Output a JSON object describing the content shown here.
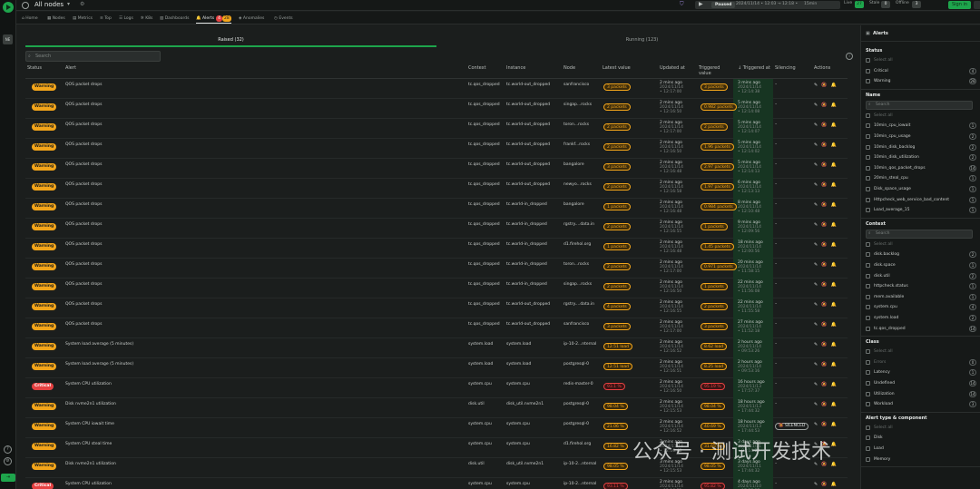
{
  "topbar": {
    "space": "All nodes",
    "state": "Paused",
    "range": "2024/11/14 • 12:03 → 12:18 • ",
    "ago": "15min",
    "live_label": "Live",
    "live_count": "27",
    "stale_label": "Stale",
    "stale_count": "0",
    "offline_label": "Offline",
    "offline_count": "3",
    "signin": "Sign in",
    "alerts_count": "1"
  },
  "rail": {
    "node_short": "NE"
  },
  "tabs": [
    "Home",
    "Nodes",
    "Metrics",
    "Top",
    "Logs",
    "K8s",
    "Dashboards",
    "Alerts",
    "Anomalies",
    "Events"
  ],
  "alert_badges": {
    "critical": "4",
    "warning": "28"
  },
  "subtabs": {
    "raised": "Raised (32)",
    "running": "Running (123)"
  },
  "search_placeholder": "Search",
  "columns": [
    "Status",
    "Alert",
    "Context",
    "Instance",
    "Node",
    "Latest value",
    "Updated at",
    "Triggered value",
    "↓ Triggered at",
    "Silencing",
    "Actions"
  ],
  "rows": [
    {
      "status": "Warning",
      "alert": "QOS packet drops",
      "context": "tc.qos_dropped",
      "instance": "tc.world-out_dropped",
      "node": "sanfrancisco",
      "value": "3 packets",
      "updated": "2 mins ago",
      "updated_ts": "2024/11/14 • 12:17:00",
      "tvalue": "3 packets",
      "tat": "3 mins ago",
      "tat_ts": "2024/11/14 • 12:14:38",
      "sil": "–"
    },
    {
      "status": "Warning",
      "alert": "QOS packet drops",
      "context": "tc.qos_dropped",
      "instance": "tc.world-out_dropped",
      "node": "singap...rocks",
      "value": "2 packets",
      "updated": "2 mins ago",
      "updated_ts": "2024/11/14 • 12:16:50",
      "tvalue": "0.982 packets",
      "tat": "5 mins ago",
      "tat_ts": "2024/11/14 • 12:14:08",
      "sil": "–"
    },
    {
      "status": "Warning",
      "alert": "QOS packet drops",
      "context": "tc.qos_dropped",
      "instance": "tc.world-out_dropped",
      "node": "toron...rocks",
      "value": "2 packets",
      "updated": "2 mins ago",
      "updated_ts": "2024/11/14 • 12:17:00",
      "tvalue": "2 packets",
      "tat": "5 mins ago",
      "tat_ts": "2024/11/14 • 12:14:07",
      "sil": "–"
    },
    {
      "status": "Warning",
      "alert": "QOS packet drops",
      "context": "tc.qos_dropped",
      "instance": "tc.world-out_dropped",
      "node": "frankf...rocks",
      "value": "2 packets",
      "updated": "2 mins ago",
      "updated_ts": "2024/11/14 • 12:16:50",
      "tvalue": "1.96 packets",
      "tat": "5 mins ago",
      "tat_ts": "2024/11/14 • 12:14:02",
      "sil": "–"
    },
    {
      "status": "Warning",
      "alert": "QOS packet drops",
      "context": "tc.qos_dropped",
      "instance": "tc.world-out_dropped",
      "node": "bangalore",
      "value": "3 packets",
      "updated": "2 mins ago",
      "updated_ts": "2024/11/14 • 12:16:48",
      "tvalue": "2.97 packets",
      "tat": "5 mins ago",
      "tat_ts": "2024/11/14 • 12:14:13",
      "sil": "–"
    },
    {
      "status": "Warning",
      "alert": "QOS packet drops",
      "context": "tc.qos_dropped",
      "instance": "tc.world-out_dropped",
      "node": "newyo...rocks",
      "value": "2 packets",
      "updated": "2 mins ago",
      "updated_ts": "2024/11/14 • 12:16:58",
      "tvalue": "1.97 packets",
      "tat": "6 mins ago",
      "tat_ts": "2024/11/14 • 12:13:13",
      "sil": "–"
    },
    {
      "status": "Warning",
      "alert": "QOS packet drops",
      "context": "tc.qos_dropped",
      "instance": "tc.world-in_dropped",
      "node": "bangalore",
      "value": "1 packets",
      "updated": "2 mins ago",
      "updated_ts": "2024/11/14 • 12:16:48",
      "tvalue": "0.984 packets",
      "tat": "8 mins ago",
      "tat_ts": "2024/11/14 • 12:10:48",
      "sil": "–"
    },
    {
      "status": "Warning",
      "alert": "QOS packet drops",
      "context": "tc.qos_dropped",
      "instance": "tc.world-in_dropped",
      "node": "rgstry....data.in",
      "value": "2 packets",
      "updated": "2 mins ago",
      "updated_ts": "2024/11/14 • 12:16:55",
      "tvalue": "1 packets",
      "tat": "9 mins ago",
      "tat_ts": "2024/11/14 • 12:09:56",
      "sil": "–"
    },
    {
      "status": "Warning",
      "alert": "QOS packet drops",
      "context": "tc.qos_dropped",
      "instance": "tc.world-in_dropped",
      "node": "d1.firehol.org",
      "value": "1 packets",
      "updated": "2 mins ago",
      "updated_ts": "2024/11/14 • 12:16:48",
      "tvalue": "1.45 packets",
      "tat": "18 mins ago",
      "tat_ts": "2024/11/14 • 12:00:56",
      "sil": "–"
    },
    {
      "status": "Warning",
      "alert": "QOS packet drops",
      "context": "tc.qos_dropped",
      "instance": "tc.world-in_dropped",
      "node": "toron...rocks",
      "value": "2 packets",
      "updated": "2 mins ago",
      "updated_ts": "2024/11/14 • 12:17:00",
      "tvalue": "0.971 packets",
      "tat": "20 mins ago",
      "tat_ts": "2024/11/14 • 11:58:15",
      "sil": "–"
    },
    {
      "status": "Warning",
      "alert": "QOS packet drops",
      "context": "tc.qos_dropped",
      "instance": "tc.world-in_dropped",
      "node": "singap...rocks",
      "value": "2 packets",
      "updated": "2 mins ago",
      "updated_ts": "2024/11/14 • 12:16:50",
      "tvalue": "1 packets",
      "tat": "22 mins ago",
      "tat_ts": "2024/11/14 • 11:56:08",
      "sil": "–"
    },
    {
      "status": "Warning",
      "alert": "QOS packet drops",
      "context": "tc.qos_dropped",
      "instance": "tc.world-out_dropped",
      "node": "rgstry....data.in",
      "value": "4 packets",
      "updated": "2 mins ago",
      "updated_ts": "2024/11/14 • 12:16:55",
      "tvalue": "2 packets",
      "tat": "22 mins ago",
      "tat_ts": "2024/11/14 • 11:55:58",
      "sil": "–"
    },
    {
      "status": "Warning",
      "alert": "QOS packet drops",
      "context": "tc.qos_dropped",
      "instance": "tc.world-out_dropped",
      "node": "sanfrancisco",
      "value": "3 packets",
      "updated": "2 mins ago",
      "updated_ts": "2024/11/14 • 12:17:00",
      "tvalue": "3 packets",
      "tat": "27 mins ago",
      "tat_ts": "2024/11/14 • 11:52:18",
      "sil": "–"
    },
    {
      "status": "Warning",
      "alert": "System load average (5 minutes)",
      "context": "system.load",
      "instance": "system.load",
      "node": "ip-10-2...nternal",
      "value": "12.51 load",
      "updated": "2 mins ago",
      "updated_ts": "2024/11/14 • 12:16:52",
      "tvalue": "8.62 load",
      "tat": "2 hours ago",
      "tat_ts": "2024/11/14 • 09:53:26",
      "sil": "–"
    },
    {
      "status": "Warning",
      "alert": "System load average (5 minutes)",
      "context": "system.load",
      "instance": "system.load",
      "node": "postgresql-0",
      "value": "12.51 load",
      "updated": "2 mins ago",
      "updated_ts": "2024/11/14 • 12:16:51",
      "tvalue": "8.25 load",
      "tat": "2 hours ago",
      "tat_ts": "2024/11/14 • 09:53:16",
      "sil": "–"
    },
    {
      "status": "Critical",
      "alert": "System CPU utilization",
      "context": "system.cpu",
      "instance": "system.cpu",
      "node": "redis-master-0",
      "value": "93.1 %",
      "updated": "2 mins ago",
      "updated_ts": "2024/11/14 • 12:16:50",
      "tvalue": "95.19 %",
      "tat": "16 hours ago",
      "tat_ts": "2024/11/13 • 17:57:37",
      "sil": "–"
    },
    {
      "status": "Warning",
      "alert": "Disk nvme2n1 utilization",
      "context": "disk.util",
      "instance": "disk_util.nvme2n1",
      "node": "postgresql-0",
      "value": "98.04 %",
      "updated": "2 mins ago",
      "updated_ts": "2024/11/14 • 12:15:53",
      "tvalue": "98.04 %",
      "tat": "18 hours ago",
      "tat_ts": "2024/11/13 • 17:44:32",
      "sil": "–"
    },
    {
      "status": "Warning",
      "alert": "System CPU iowait time",
      "context": "system.cpu",
      "instance": "system.cpu",
      "node": "postgresql-0",
      "value": "21.06 %",
      "updated": "2 mins ago",
      "updated_ts": "2024/11/14 • 12:16:52",
      "tvalue": "40.69 %",
      "tat": "18 hours ago",
      "tat_ts": "2024/11/13 • 17:44:53",
      "sil": "SILENCED"
    },
    {
      "status": "Warning",
      "alert": "System CPU steal time",
      "context": "system.cpu",
      "instance": "system.cpu",
      "node": "d1.firehol.org",
      "value": "16.82 %",
      "updated": "2 mins ago",
      "updated_ts": "2024/11/14 • 12:16:48",
      "tvalue": "31.65 %",
      "tat": "3 days ago",
      "tat_ts": "2024/11/11 • 04:14:29",
      "sil": "–"
    },
    {
      "status": "Warning",
      "alert": "Disk nvme2n1 utilization",
      "context": "disk.util",
      "instance": "disk_util.nvme2n1",
      "node": "ip-10-2...nternal",
      "value": "98.05 %",
      "updated": "3 mins ago",
      "updated_ts": "2024/11/14 • 12:15:53",
      "tvalue": "98.05 %",
      "tat": "3 days ago",
      "tat_ts": "2024/11/11 • 17:44:32",
      "sil": "–"
    },
    {
      "status": "Critical",
      "alert": "System CPU utilization",
      "context": "system.cpu",
      "instance": "system.cpu",
      "node": "ip-10-2...nternal",
      "value": "93.11 %",
      "updated": "2 mins ago",
      "updated_ts": "2024/11/14 • 12:16:52",
      "tvalue": "95.82 %",
      "tat": "4 days ago",
      "tat_ts": "2024/11/10 • 17:57:37",
      "sil": "–"
    }
  ],
  "side": {
    "title": "Alerts",
    "status_title": "Status",
    "status_items": [
      {
        "label": "Select all",
        "count": ""
      },
      {
        "label": "Critical",
        "count": "4"
      },
      {
        "label": "Warning",
        "count": "28"
      }
    ],
    "name_title": "Name",
    "name_items": [
      {
        "label": "Select all",
        "count": ""
      },
      {
        "label": "10min_cpu_iowait",
        "count": "1"
      },
      {
        "label": "10min_cpu_usage",
        "count": "2"
      },
      {
        "label": "10min_disk_backlog",
        "count": "2"
      },
      {
        "label": "10min_disk_utilization",
        "count": "2"
      },
      {
        "label": "10min_qos_packet_drops",
        "count": "14"
      },
      {
        "label": "20min_steal_cpu",
        "count": "1"
      },
      {
        "label": "Disk_space_usage",
        "count": "1"
      },
      {
        "label": "Httpcheck_web_service_bad_content",
        "count": "1"
      },
      {
        "label": "Load_average_15",
        "count": "1"
      }
    ],
    "context_title": "Context",
    "context_items": [
      {
        "label": "Select all",
        "count": ""
      },
      {
        "label": "disk.backlog",
        "count": "2"
      },
      {
        "label": "disk.space",
        "count": "1"
      },
      {
        "label": "disk.util",
        "count": "2"
      },
      {
        "label": "httpcheck.status",
        "count": "1"
      },
      {
        "label": "mem.available",
        "count": "1"
      },
      {
        "label": "system.cpu",
        "count": "4"
      },
      {
        "label": "system.load",
        "count": "2"
      },
      {
        "label": "tc.qos_dropped",
        "count": "14"
      }
    ],
    "class_title": "Class",
    "class_items": [
      {
        "label": "Select all",
        "count": ""
      },
      {
        "label": "Errors",
        "count": "0"
      },
      {
        "label": "Latency",
        "count": "1"
      },
      {
        "label": "Undefined",
        "count": "14"
      },
      {
        "label": "Utilization",
        "count": "14"
      },
      {
        "label": "Workload",
        "count": "3"
      }
    ],
    "type_title": "Alert type & component",
    "type_items": [
      {
        "label": "Select all",
        "count": ""
      },
      {
        "label": "Disk",
        "count": ""
      },
      {
        "label": "Load",
        "count": ""
      },
      {
        "label": "Memory",
        "count": ""
      }
    ]
  },
  "watermark": "公众号 · 测试开发技术"
}
